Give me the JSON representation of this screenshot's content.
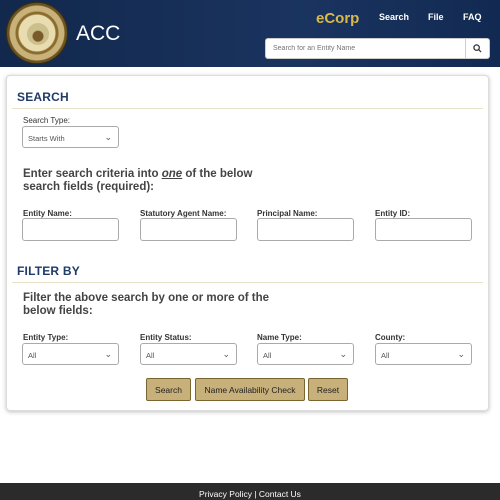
{
  "header": {
    "seal_text": "THE ARIZONA CORPORATION COMMISSION 1912",
    "title": "ACC",
    "brand": "eCorp",
    "nav": {
      "search": "Search",
      "file": "File",
      "faq": "FAQ"
    },
    "search_placeholder": "Search for an Entity Name",
    "search_button_icon": "search-icon"
  },
  "search_section": {
    "title": "SEARCH",
    "search_type_label": "Search Type:",
    "search_type_value": "Starts With",
    "instructions_pre": "Enter search criteria into ",
    "instructions_em": "one",
    "instructions_post": " of the below search fields (required):",
    "fields": {
      "entity_name": "Entity Name:",
      "statutory_agent_name": "Statutory Agent Name:",
      "principal_name": "Principal Name:",
      "entity_id": "Entity ID:"
    }
  },
  "filter_section": {
    "title": "FILTER BY",
    "instructions": "Filter the above search by one or more of the below fields:",
    "filters": {
      "entity_type": {
        "label": "Entity Type:",
        "value": "All"
      },
      "entity_status": {
        "label": "Entity Status:",
        "value": "All"
      },
      "name_type": {
        "label": "Name Type:",
        "value": "All"
      },
      "county": {
        "label": "County:",
        "value": "All"
      }
    }
  },
  "buttons": {
    "search": "Search",
    "name_availability": "Name Availability Check",
    "reset": "Reset"
  },
  "footer": {
    "privacy": "Privacy Policy",
    "separator": " | ",
    "contact": "Contact Us"
  },
  "colors": {
    "header_bg": "#12284c",
    "brand": "#d9b94a",
    "section_title": "#1f3b68",
    "button_bg": "#c8b07a",
    "footer_bg": "#2b2b2b"
  }
}
